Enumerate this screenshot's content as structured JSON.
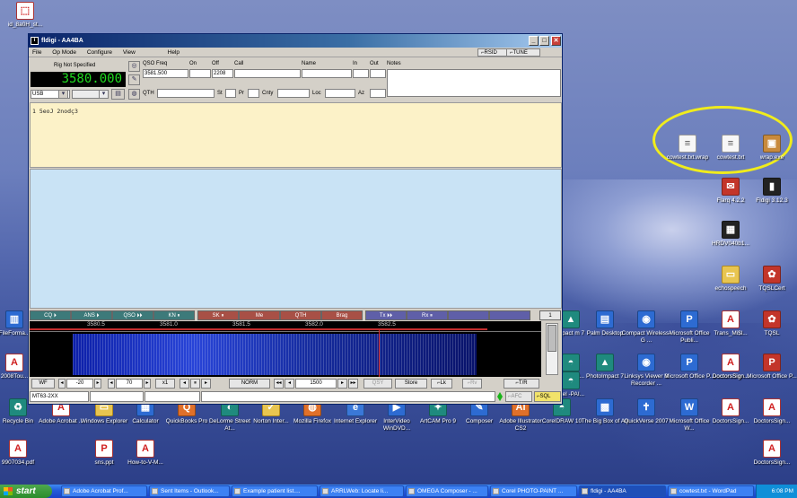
{
  "desktop": {
    "icons_top": [
      {
        "label": "id_8a0H_st...",
        "kind": "pdf",
        "glyph": "⬚"
      }
    ],
    "icons_circled": [
      {
        "label": "cowtest.txt.wrap",
        "kind": "doc",
        "glyph": "≡"
      },
      {
        "label": "cowtest.txt",
        "kind": "doc",
        "glyph": "≡"
      },
      {
        "label": "wrap.exe",
        "kind": "exe",
        "glyph": "▣"
      }
    ],
    "icons_right": [
      {
        "label": "Flarq 4.2.2",
        "kind": "red",
        "glyph": "✉"
      },
      {
        "label": "Fldigi 3.12.3",
        "kind": "dark",
        "glyph": "▮"
      },
      {
        "label": "HRDV040b1...",
        "kind": "dark",
        "glyph": "▦"
      },
      {
        "label": "echospeech",
        "kind": "fold",
        "glyph": "▭"
      },
      {
        "label": "TQSLCert",
        "kind": "red",
        "glyph": "✿"
      },
      {
        "label": "TQSL",
        "kind": "red",
        "glyph": "✿"
      },
      {
        "label": "Microsoft Office P...",
        "kind": "red",
        "glyph": "P"
      },
      {
        "label": "DoctorsSign...",
        "kind": "pdf",
        "glyph": "A"
      },
      {
        "label": "DoctorsSign...",
        "kind": "pdf",
        "glyph": "A"
      }
    ],
    "icons_row1": [
      {
        "label": "Palm Desktop",
        "kind": "app",
        "glyph": "▤"
      },
      {
        "label": "Compact Wireless-G ...",
        "kind": "app",
        "glyph": "◉"
      },
      {
        "label": "Microsoft Office Publi...",
        "kind": "app",
        "glyph": "P"
      },
      {
        "label": "Trans_Mi$l...",
        "kind": "pdf",
        "glyph": "A"
      }
    ],
    "icons_row2": [
      {
        "label": "PhotoImpact 7",
        "kind": "mag",
        "glyph": "▲"
      },
      {
        "label": "Linksys Viewer & Recorder ...",
        "kind": "app",
        "glyph": "◉"
      },
      {
        "label": "Microsoft Office P...",
        "kind": "app",
        "glyph": "P"
      },
      {
        "label": "DoctorsSign...",
        "kind": "pdf",
        "glyph": "A"
      }
    ],
    "icons_bottom": [
      {
        "label": "Recycle Bin",
        "kind": "mag",
        "glyph": "♻"
      },
      {
        "label": "Adobe Acrobat ...",
        "kind": "pdf",
        "glyph": "A"
      },
      {
        "label": "Windows Explorer",
        "kind": "fold",
        "glyph": "▭"
      },
      {
        "label": "Calculator",
        "kind": "app",
        "glyph": "▦"
      },
      {
        "label": "QuickBooks Pro",
        "kind": "ff",
        "glyph": "Q"
      },
      {
        "label": "DeLorme Street At...",
        "kind": "mag",
        "glyph": "◐"
      },
      {
        "label": "Norton Inter...",
        "kind": "fold",
        "glyph": "✓"
      },
      {
        "label": "Mozilla Firefox",
        "kind": "ff",
        "glyph": "◍"
      },
      {
        "label": "Internet Explorer",
        "kind": "ie",
        "glyph": "e"
      },
      {
        "label": "InterVideo WinDVD...",
        "kind": "app",
        "glyph": "▶"
      },
      {
        "label": "ArtCAM Pro 9",
        "kind": "mag",
        "glyph": "✦"
      },
      {
        "label": "Composer",
        "kind": "app",
        "glyph": "✎"
      },
      {
        "label": "Adobe Illustrator CS2",
        "kind": "ff",
        "glyph": "Ai"
      },
      {
        "label": "CorelDRAW 10",
        "kind": "mag",
        "glyph": "◓"
      },
      {
        "label": "The Big Box of Art",
        "kind": "app",
        "glyph": "▩"
      },
      {
        "label": "QuickVerse 2007",
        "kind": "app",
        "glyph": "✝"
      },
      {
        "label": "Microsoft Office W...",
        "kind": "app",
        "glyph": "W"
      },
      {
        "label": "DoctorsSign...",
        "kind": "pdf",
        "glyph": "A"
      },
      {
        "label": "DoctorsSign...",
        "kind": "pdf",
        "glyph": "A"
      }
    ],
    "icons_left": [
      {
        "label": "FileForma...",
        "kind": "app",
        "glyph": "▥"
      },
      {
        "label": "2008Tou...",
        "kind": "pdf",
        "glyph": "A"
      },
      {
        "label": "9907034.pdf",
        "kind": "pdf",
        "glyph": "A"
      },
      {
        "label": "sns.ppt",
        "kind": "pdf",
        "glyph": "P"
      },
      {
        "label": "How-to-V-M...",
        "kind": "pdf",
        "glyph": "A"
      }
    ],
    "icons_partial": [
      {
        "label": "mpact m 7",
        "kind": "mag",
        "glyph": "▲"
      },
      {
        "label": "orel -PAI...",
        "kind": "mag",
        "glyph": "◓"
      },
      {
        "label": "orel -PAI...",
        "kind": "mag",
        "glyph": "◓"
      }
    ]
  },
  "fldigi": {
    "title": "fldigi - AA4BA",
    "menu": [
      "File",
      "Op Mode",
      "Configure",
      "View",
      "Help"
    ],
    "rsid": "RSID",
    "tune": "TUNE",
    "rig": "Rig Not Specified",
    "freq_display": "3580.000",
    "mode": "USB",
    "labels": {
      "qso_freq": "QSO Freq",
      "on": "On",
      "off": "Off",
      "call": "Call",
      "name": "Name",
      "in": "In",
      "out": "Out",
      "notes": "Notes",
      "qth": "QTH",
      "st": "St",
      "pr": "Pr",
      "cnty": "Cnty",
      "loc": "Loc",
      "az": "Az"
    },
    "qso_freq": "3581.500",
    "off_time": "2208",
    "rx_text": "1 5eoJ 2nodç3",
    "macros": [
      {
        "label": "CQ ⏵",
        "group": "g1"
      },
      {
        "label": "ANS ⏵",
        "group": "g1"
      },
      {
        "label": "QSO ⏵⏵",
        "group": "g1"
      },
      {
        "label": "KN ⏸",
        "group": "g1"
      },
      {
        "label": "SK ⏸",
        "group": "g2"
      },
      {
        "label": "Me",
        "group": "g2"
      },
      {
        "label": "QTH",
        "group": "g2"
      },
      {
        "label": "Brag",
        "group": "g2"
      },
      {
        "label": "Tx ⏵⏵",
        "group": "g3"
      },
      {
        "label": "Rx ⏸",
        "group": "g3"
      },
      {
        "label": "",
        "group": "g3"
      },
      {
        "label": "",
        "group": "g3"
      }
    ],
    "macro_page": "1",
    "scale": [
      "3580.5",
      "3581.0",
      "3581.5",
      "3582.0",
      "3582.5"
    ],
    "controls": {
      "wf": "WF",
      "ref": "-20",
      "range": "70",
      "x1": "x1",
      "norm": "NORM",
      "freq": "1500",
      "qsy": "QSY",
      "store": "Store",
      "lk": "Lk",
      "rv": "Rv",
      "tr": "T/R"
    },
    "status": {
      "mode": "MT63-2XX",
      "afc": "AFC",
      "sql": "SQL"
    }
  },
  "taskbar": {
    "start": "start",
    "tasks": [
      "Adobe Acrobat Prof...",
      "Sent Items - Outlook...",
      "Example patient list....",
      "ARRLWeb: Locate li...",
      "OMEGA Composer - ...",
      "Corel PHOTO-PAINT ...",
      "fldigi - AA4BA",
      "cowtest.txt - WordPad"
    ],
    "clock": "6:08 PM"
  }
}
